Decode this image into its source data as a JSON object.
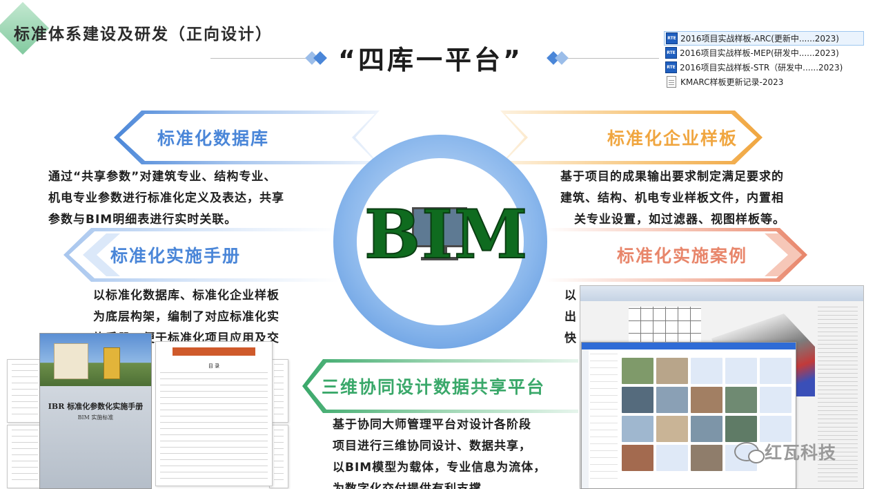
{
  "header": {
    "section_title": "标准体系建设及研发（正向设计）",
    "main_title": "“四库一平台”"
  },
  "files": [
    {
      "icon": "rte-file-icon",
      "icon_text": "RTE",
      "name": "2016项目实战样板-ARC(更新中......2023)",
      "selected": true
    },
    {
      "icon": "rte-file-icon",
      "icon_text": "RTE",
      "name": "2016项目实战样板-MEP(研发中......2023)",
      "selected": false
    },
    {
      "icon": "rte-file-icon",
      "icon_text": "RTE",
      "name": "2016项目实战样板-STR（研发中......2023)",
      "selected": false
    },
    {
      "icon": "text-file-icon",
      "icon_text": "",
      "name": "KMARC样板更新记录-2023",
      "selected": false
    }
  ],
  "center": {
    "text": "BIM"
  },
  "pillars": {
    "database": {
      "title": "标准化数据库",
      "lines": [
        "通过“共享参数”对建筑专业、结构专业、",
        "机电专业参数进行标准化定义及表达，共享",
        "参数与BIM明细表进行实时关联。"
      ]
    },
    "template": {
      "title": "标准化企业样板",
      "lines": [
        "基于项目的成果输出要求制定满足要求的",
        "建筑、结构、机电专业样板文件，内置相",
        "关专业设置，如过滤器、视图样板等。"
      ]
    },
    "manual": {
      "title": "标准化实施手册",
      "lines": [
        "以标准化数据库、标准化企业样板",
        "为底层构架，编制了对应标准化实",
        "施手册，便于标准化项目应用及交"
      ]
    },
    "cases": {
      "title": "标准化实施案例",
      "lines": [
        "以",
        "出",
        "快"
      ]
    },
    "platform": {
      "title": "三维协同设计数据共享平台",
      "lines": [
        "基于协同大师管理平台对设计各阶段",
        "项目进行三维协同设计、数据共享，",
        "以BIM模型为载体，专业信息为流体，",
        "为数字化交付提供有利支撑。"
      ]
    }
  },
  "manual_cover": {
    "title": "IBR 标准化参数化实施手册",
    "subtitle": "BIM 实施标准"
  },
  "manual_toc": {
    "heading": "目 录"
  },
  "watermark": {
    "text": "红瓦科技"
  },
  "colors": {
    "blue": "#4a86d8",
    "orange": "#f0a640",
    "salmon": "#e8866b",
    "green": "#3aa86a",
    "bim_green": "#0f6b1f"
  }
}
